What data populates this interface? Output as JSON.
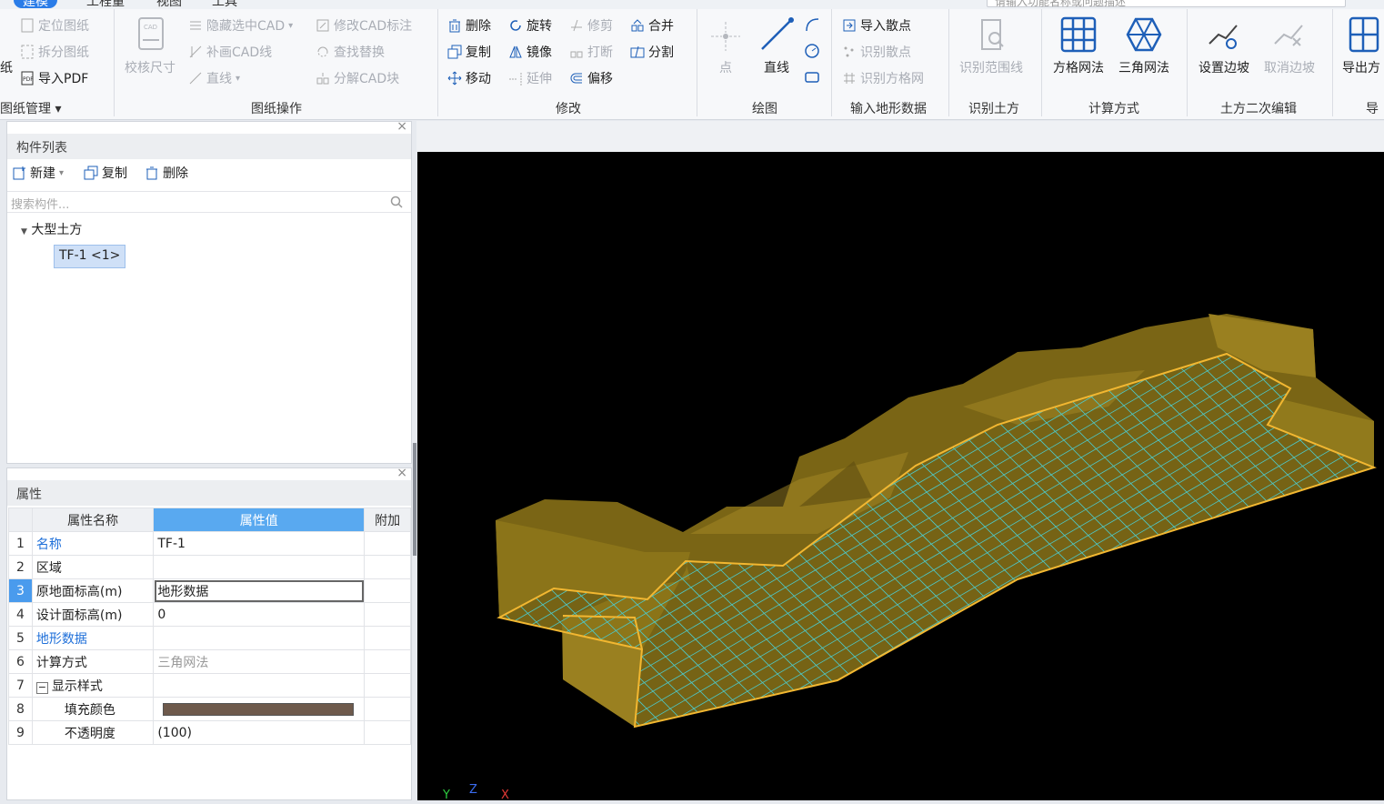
{
  "tabs": [
    "建模",
    "工程量",
    "视图",
    "工具"
  ],
  "search_placeholder": "请输入功能名称或问题描述",
  "ribbon": {
    "drawing_mgmt": {
      "partial_big": "纸",
      "items": [
        "定位图纸",
        "拆分图纸",
        "导入PDF"
      ],
      "group": "图纸管理"
    },
    "drawing_ops": {
      "check_size": "校核尺寸",
      "items": [
        "隐藏选中CAD",
        "补画CAD线",
        "直线",
        "修改CAD标注",
        "查找替换",
        "分解CAD块"
      ],
      "group": "图纸操作"
    },
    "modify": {
      "items": [
        "删除",
        "旋转",
        "修剪",
        "合并",
        "复制",
        "镜像",
        "打断",
        "分割",
        "移动",
        "延伸",
        "偏移"
      ],
      "group": "修改"
    },
    "draw": {
      "point": "点",
      "line": "直线",
      "group": "绘图"
    },
    "terrain": {
      "items": [
        "导入散点",
        "识别散点",
        "识别方格网"
      ],
      "group": "输入地形数据"
    },
    "identify": {
      "item": "识别范围线",
      "group": "识别土方"
    },
    "calc": {
      "items": [
        "方格网法",
        "三角网法"
      ],
      "group": "计算方式"
    },
    "edit2": {
      "items": [
        "设置边坡",
        "取消边坡"
      ],
      "group": "土方二次编辑"
    },
    "export": {
      "item": "导出方",
      "group": "导"
    }
  },
  "component_panel": {
    "title": "构件列表",
    "new": "新建",
    "copy": "复制",
    "delete": "删除",
    "search_placeholder": "搜索构件...",
    "tree_root": "大型土方",
    "tree_child": "TF-1 <1>"
  },
  "props_panel": {
    "title": "属性",
    "headers": [
      "属性名称",
      "属性值",
      "附加"
    ],
    "rows": [
      {
        "n": "1",
        "name": "名称",
        "value": "TF-1"
      },
      {
        "n": "2",
        "name": "区域",
        "value": ""
      },
      {
        "n": "3",
        "name": "原地面标高(m)",
        "value": "地形数据"
      },
      {
        "n": "4",
        "name": "设计面标高(m)",
        "value": "0"
      },
      {
        "n": "5",
        "name": "地形数据",
        "value": ""
      },
      {
        "n": "6",
        "name": "计算方式",
        "value": "三角网法"
      },
      {
        "n": "7",
        "name": "显示样式",
        "value": ""
      },
      {
        "n": "8",
        "name": "填充颜色",
        "value": ""
      },
      {
        "n": "9",
        "name": "不透明度",
        "value": "(100)"
      }
    ],
    "fill_color": "#6e5a4c"
  },
  "axes": {
    "y": "Y",
    "z": "Z",
    "x": "X"
  },
  "colors": {
    "accent": "#2a7ce8",
    "terrain": "#8b7419",
    "outline": "#f2b731",
    "grid": "#4ec9c9"
  }
}
